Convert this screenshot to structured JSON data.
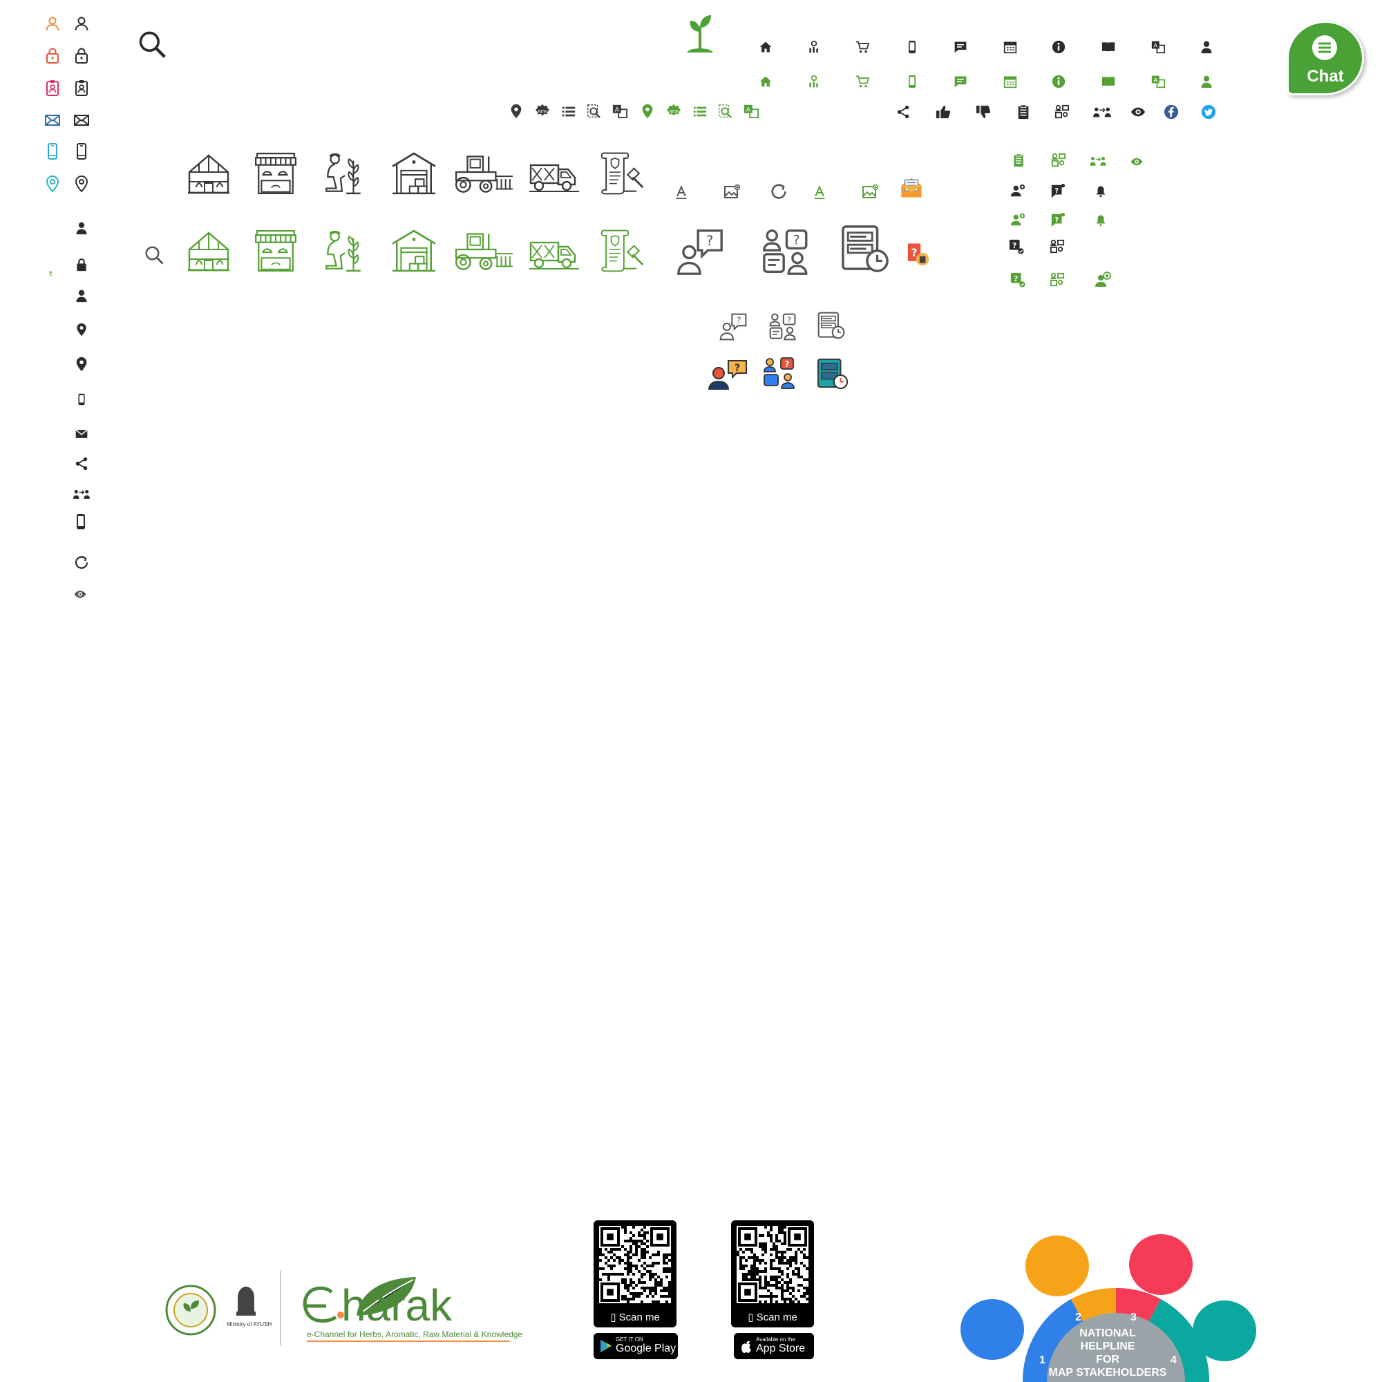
{
  "chat": {
    "label": "Chat"
  },
  "rupee_symbol": "₹",
  "colors": {
    "green": "#56a135",
    "dark": "#2b2b2b",
    "facebook": "#3b5998",
    "twitter": "#1da1f2",
    "helpline": [
      "#2f80e8",
      "#f7a31a",
      "#f53b57",
      "#0aa89e"
    ]
  },
  "icons": {
    "left_color_column": [
      "user-icon",
      "lock-icon",
      "id-card-icon",
      "mail-icon",
      "mobile-icon",
      "location-pin-icon"
    ],
    "left_dark_column": [
      "user-icon",
      "lock-icon",
      "id-card-icon",
      "mail-icon",
      "mobile-icon",
      "location-pin-icon"
    ],
    "left_small_column": [
      "user-icon",
      "lock-icon",
      "user-icon",
      "location-pin-icon",
      "map-user-icon",
      "mobile-icon",
      "mail-icon",
      "network-icon",
      "transfer-icon",
      "app-notification-icon",
      "refresh-icon",
      "eye-icon"
    ],
    "nav_row": [
      "home-icon",
      "chart-icon",
      "cart-icon",
      "mobile-icon",
      "message-icon",
      "calendar-icon",
      "info-icon",
      "book-icon",
      "translate-icon",
      "user-icon"
    ],
    "utility_row": [
      "location-pin-icon",
      "new-badge-icon",
      "list-icon",
      "search-doc-icon",
      "translate-icon"
    ],
    "social_row": [
      "share-icon",
      "thumbs-up-icon",
      "thumbs-down-icon",
      "clipboard-icon",
      "org-chart-icon",
      "exchange-users-icon",
      "eye-icon",
      "facebook-icon",
      "twitter-icon"
    ],
    "stakeholders": [
      "greenhouse-icon",
      "market-stall-icon",
      "farmer-icon",
      "warehouse-icon",
      "tractor-icon",
      "truck-icon",
      "legal-document-icon"
    ]
  },
  "qr": [
    {
      "scan_label": "Scan me",
      "store_small": "GET IT ON",
      "store_big": "Google Play"
    },
    {
      "scan_label": "Scan me",
      "store_small": "Available on the",
      "store_big": "App Store"
    }
  ],
  "footer": {
    "brand": "harak",
    "brand_prefix": "e.",
    "tagline": "e-Channel for Herbs, Aromatic, Raw Material & Knowledge",
    "ministry": "Ministry of AYUSH"
  },
  "helpline": {
    "line1": "NATIONAL",
    "line2": "HELPLINE",
    "line3": "FOR",
    "line4": "MAP STAKEHOLDERS",
    "numbers": [
      "1",
      "2",
      "3",
      "4"
    ]
  }
}
